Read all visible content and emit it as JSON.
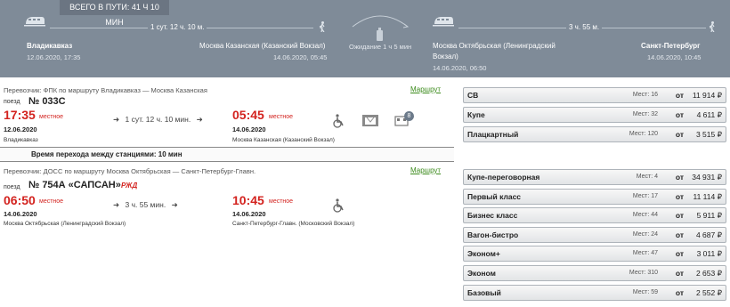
{
  "header": {
    "total_time": "ВСЕГО В ПУТИ: 41 Ч 10 МИН",
    "leg1": {
      "duration": "1 сут. 12 ч. 10 м.",
      "from_station": "Владикавказ",
      "from_date": "12.06.2020, 17:35",
      "to_station": "Москва Казанская (Казанский Вокзал)",
      "to_date": "14.06.2020, 05:45"
    },
    "transfer": "Ожидание 1 ч 5 мин",
    "leg2": {
      "duration": "3 ч. 55 м.",
      "from_station_line1": "Москва Октябрьская (Ленинградский",
      "from_station_line2": "Вокзал)",
      "from_date": "14.06.2020, 06:50",
      "to_station": "Санкт-Петербург",
      "to_date": "14.06.2020, 10:45"
    }
  },
  "segments": [
    {
      "carrier": "Перевозчик: ФПК   по маршруту Владикавказ — Москва Казанская",
      "route_link": "Маршрут",
      "train_word": "поезд",
      "train_number": "№ 033С",
      "dep_time": "17:35",
      "dep_local": "местное",
      "dep_date": "12.06.2020",
      "dep_station": "Владикавказ",
      "travel": "1 сут. 12 ч. 10 мин.",
      "arr_time": "05:45",
      "arr_local": "местное",
      "arr_date": "14.06.2020",
      "arr_station": "Москва Казанская (Казанский Вокзал)",
      "badge": "8"
    },
    {
      "carrier": "Перевозчик: ДОСС   по маршруту Москва Октябрьская — Санкт-Петербург-Главн.",
      "route_link": "Маршрут",
      "train_word": "поезд",
      "train_number": "№ 754А «САПСАН»",
      "logo": "РЖД",
      "dep_time": "06:50",
      "dep_local": "местное",
      "dep_date": "14.06.2020",
      "dep_station": "Москва Октябрьская (Ленинградский Вокзал)",
      "travel": "3 ч. 55 мин.",
      "arr_time": "10:45",
      "arr_local": "местное",
      "arr_date": "14.06.2020",
      "arr_station": "Санкт-Петербург-Главн. (Московский Вокзал)"
    }
  ],
  "wait_text": "Время перехода между станциями: 10 мин",
  "classes1": [
    {
      "name": "СВ",
      "seats": "Мест: 16",
      "from": "от",
      "price": "11 914 ₽"
    },
    {
      "name": "Купе",
      "seats": "Мест: 32",
      "from": "от",
      "price": "4 611 ₽"
    },
    {
      "name": "Плацкартный",
      "seats": "Мест: 120",
      "from": "от",
      "price": "3 515 ₽"
    }
  ],
  "classes2": [
    {
      "name": "Купе-переговорная",
      "seats": "Мест: 4",
      "from": "от",
      "price": "34 931 ₽"
    },
    {
      "name": "Первый класс",
      "seats": "Мест: 17",
      "from": "от",
      "price": "11 114 ₽"
    },
    {
      "name": "Бизнес класс",
      "seats": "Мест: 44",
      "from": "от",
      "price": "5 911 ₽"
    },
    {
      "name": "Вагон-бистро",
      "seats": "Мест: 24",
      "from": "от",
      "price": "4 687 ₽"
    },
    {
      "name": "Эконом+",
      "seats": "Мест: 47",
      "from": "от",
      "price": "3 011 ₽"
    },
    {
      "name": "Эконом",
      "seats": "Мест: 310",
      "from": "от",
      "price": "2 653 ₽"
    },
    {
      "name": "Базовый",
      "seats": "Мест: 59",
      "from": "от",
      "price": "2 552 ₽"
    }
  ],
  "colors": {
    "header_bg": "#7f8b98",
    "time_red": "#d3231f",
    "link_green": "#3a8a1a"
  }
}
